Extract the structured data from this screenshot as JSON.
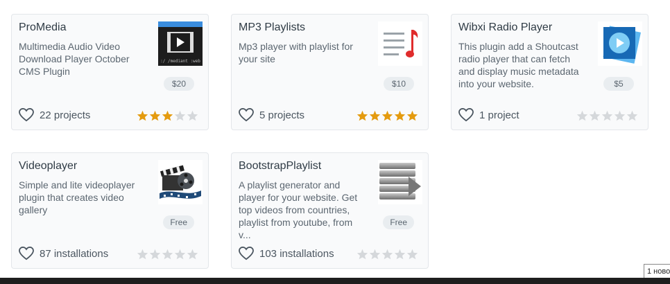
{
  "colors": {
    "star_on": "#e49b0f",
    "star_off": "#d5d8db",
    "card_bg": "#f9fafb"
  },
  "cards": [
    {
      "title": "ProMedia",
      "description": "Multimedia Audio Video Download Player October CMS Plugin",
      "price": "$20",
      "stat": "22 projects",
      "rating": 3,
      "thumb_icon": "film-strip-icon",
      "thumb_caption": ":/ /mediant :web"
    },
    {
      "title": "MP3 Playlists",
      "description": "Mp3 player with playlist for your site",
      "price": "$10",
      "stat": "5 projects",
      "rating": 5,
      "thumb_icon": "playlist-music-note-icon"
    },
    {
      "title": "Wibxi Radio Player",
      "description": "This plugin add a Shoutcast radio player that can fetch and display music metadata into your website.",
      "price": "$5",
      "stat": "1 project",
      "rating": 0,
      "thumb_icon": "play-button-icon"
    },
    {
      "title": "Videoplayer",
      "description": "Simple and lite videoplayer plugin that creates video gallery",
      "price": "Free",
      "stat": "87 installations",
      "rating": 0,
      "thumb_icon": "film-reel-clapper-icon"
    },
    {
      "title": "BootstrapPlaylist",
      "description": "A playlist generator and player for your website. Get top videos from countries, playlist from youtube, from v...",
      "price": "Free",
      "stat": "103 installations",
      "rating": 0,
      "thumb_icon": "stacked-bars-play-icon"
    }
  ],
  "tooltip_text": "1 ново"
}
